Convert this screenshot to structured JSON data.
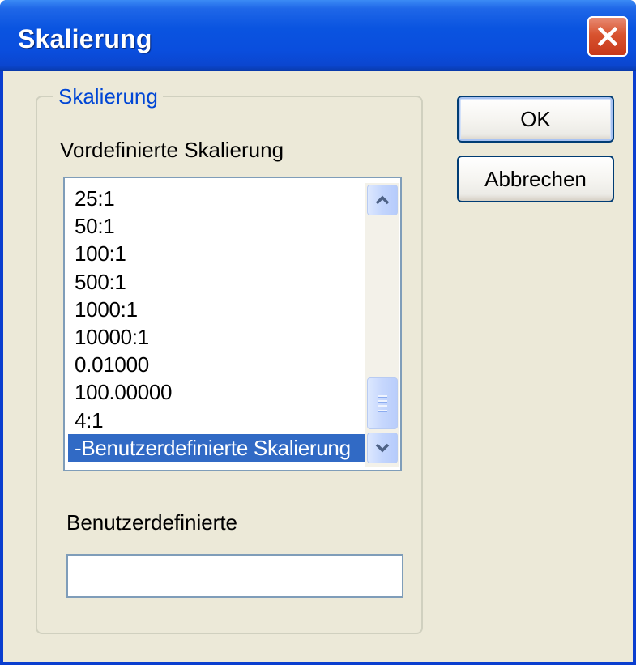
{
  "window": {
    "title": "Skalierung"
  },
  "group": {
    "legend": "Skalierung",
    "predefined_label": "Vordefinierte Skalierung",
    "scale_list": [
      "25:1",
      "50:1",
      "100:1",
      "500:1",
      "1000:1",
      "10000:1",
      "0.01000",
      "100.00000",
      "4:1",
      "-Benutzerdefinierte Skalierung"
    ],
    "selected_item": "-Benutzerdefinierte Skalierung",
    "custom_label": "Benutzerdefinierte",
    "custom_value": ""
  },
  "buttons": {
    "ok": "OK",
    "cancel": "Abbrechen"
  },
  "icons": {
    "close": "close-icon",
    "scroll_up": "chevron-up-icon",
    "scroll_down": "chevron-down-icon",
    "thumb_grip": "grip-icon"
  },
  "colors": {
    "title_bar": "#0a54e0",
    "window_bg": "#ece9d8",
    "selection": "#316ac5",
    "legend_text": "#0046d5",
    "close_button": "#d8532f"
  }
}
